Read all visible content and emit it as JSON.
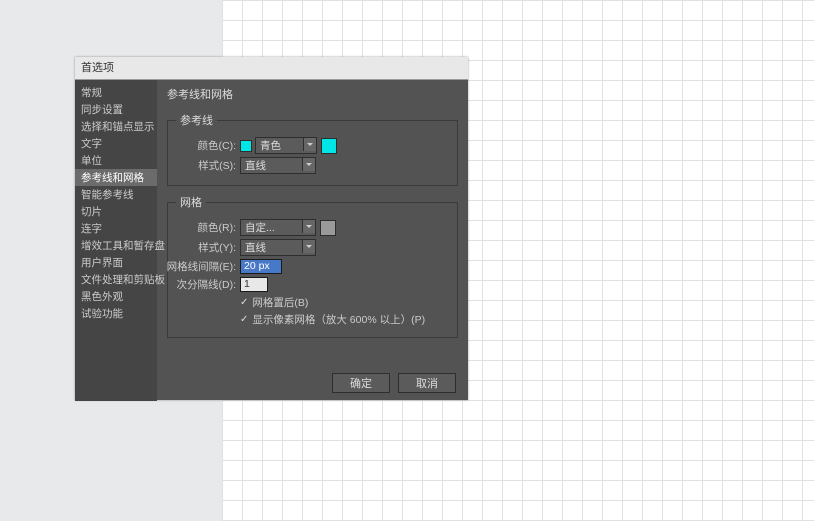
{
  "dialog": {
    "title": "首选项"
  },
  "sidebar": {
    "items": [
      {
        "label": "常规"
      },
      {
        "label": "同步设置"
      },
      {
        "label": "选择和锚点显示"
      },
      {
        "label": "文字"
      },
      {
        "label": "单位"
      },
      {
        "label": "参考线和网格",
        "selected": true
      },
      {
        "label": "智能参考线"
      },
      {
        "label": "切片"
      },
      {
        "label": "连字"
      },
      {
        "label": "增效工具和暂存盘"
      },
      {
        "label": "用户界面"
      },
      {
        "label": "文件处理和剪贴板"
      },
      {
        "label": "黑色外观"
      },
      {
        "label": "试验功能"
      }
    ]
  },
  "page": {
    "title": "参考线和网格"
  },
  "guides": {
    "legend": "参考线",
    "color_label": "颜色(C):",
    "color_value": "青色",
    "style_label": "样式(S):",
    "style_value": "直线"
  },
  "grid": {
    "legend": "网格",
    "color_label": "颜色(R):",
    "color_value": "自定...",
    "style_label": "样式(Y):",
    "style_value": "直线",
    "spacing_label": "网格线间隔(E):",
    "spacing_value": "20 px",
    "subdiv_label": "次分隔线(D):",
    "subdiv_value": "1",
    "check1": "网格置后(B)",
    "check2": "显示像素网格（放大 600% 以上）(P)"
  },
  "buttons": {
    "ok": "确定",
    "cancel": "取消"
  }
}
